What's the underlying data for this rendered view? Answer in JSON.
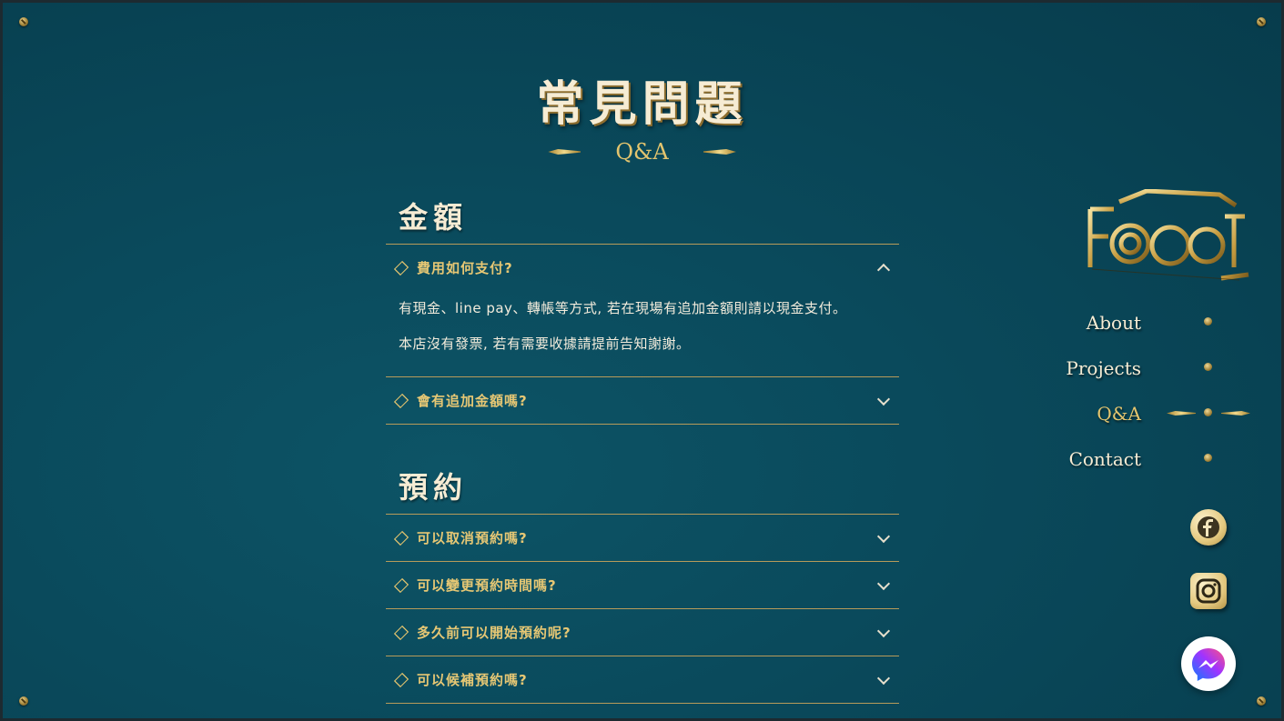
{
  "header": {
    "title": "常見問題",
    "subtitle": "Q&A"
  },
  "sections": [
    {
      "title": "金額",
      "items": [
        {
          "question": "費用如何支付?",
          "expanded": true,
          "answer": [
            "有現金、line pay、轉帳等方式, 若在現場有追加金額則請以現金支付。",
            "本店沒有發票, 若有需要收據請提前告知謝謝。"
          ]
        },
        {
          "question": "會有追加金額嗎?",
          "expanded": false
        }
      ]
    },
    {
      "title": "預約",
      "items": [
        {
          "question": "可以取消預約嗎?",
          "expanded": false
        },
        {
          "question": "可以變更預約時間嗎?",
          "expanded": false
        },
        {
          "question": "多久前可以開始預約呢?",
          "expanded": false
        },
        {
          "question": "可以候補預約嗎?",
          "expanded": false
        }
      ]
    }
  ],
  "nav": {
    "items": [
      {
        "label": "About"
      },
      {
        "label": "Projects"
      },
      {
        "label": "Q&A",
        "active": true
      },
      {
        "label": "Contact"
      }
    ]
  },
  "social": {
    "icons": [
      "facebook-icon",
      "instagram-icon",
      "messenger-icon"
    ],
    "colors": {
      "gold": "#e3c46e",
      "messenger_start": "#0a7cff",
      "messenger_end": "#ff5280"
    }
  }
}
